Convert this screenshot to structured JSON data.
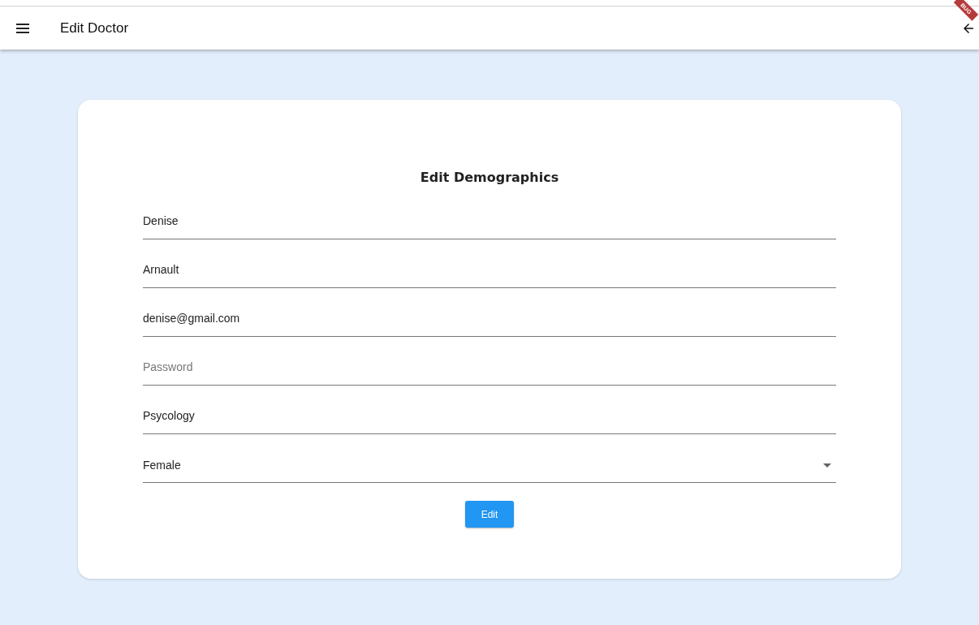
{
  "app_bar": {
    "title": "Edit Doctor",
    "debug_banner": "BUG"
  },
  "form": {
    "title": "Edit Demographics",
    "fields": [
      {
        "kind": "text",
        "value": "Denise"
      },
      {
        "kind": "text",
        "value": "Arnault"
      },
      {
        "kind": "text",
        "value": "denise@gmail.com"
      },
      {
        "kind": "text",
        "placeholder": "Password"
      },
      {
        "kind": "text",
        "value": "Psycology"
      },
      {
        "kind": "dropdown",
        "value": "Female"
      }
    ],
    "button": "Edit"
  }
}
